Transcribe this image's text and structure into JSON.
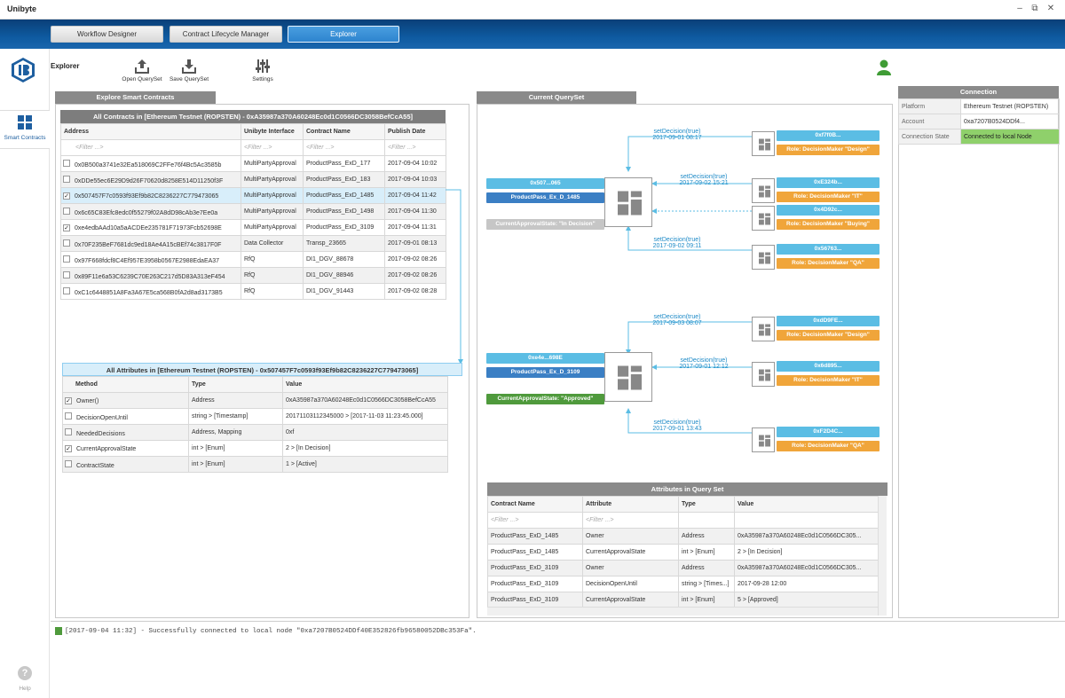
{
  "window": {
    "title": "Unibyte",
    "minimize": "‒",
    "maximize": "⧉",
    "close": "✕"
  },
  "nav": {
    "tabs": [
      {
        "label": "Workflow Designer"
      },
      {
        "label": "Contract Lifecycle Manager"
      },
      {
        "label": "Explorer"
      }
    ]
  },
  "sidebar": {
    "smart_contracts": "Smart Contracts",
    "help": "Help",
    "help_glyph": "?"
  },
  "toolbar": {
    "title": "Explorer",
    "open": "Open QuerySet",
    "save": "Save QuerySet",
    "settings": "Settings"
  },
  "explore": {
    "header": "Explore Smart Contracts",
    "contracts": {
      "caption": "All Contracts in [Ethereum Testnet (ROPSTEN) - 0xA35987a370A60248Ec0d1C0566DC3058BefCcA55]",
      "columns": [
        "Address",
        "Unibyte Interface",
        "Contract Name",
        "Publish Date"
      ],
      "filter": "<Filter ...>",
      "rows": [
        {
          "checked": false,
          "address": "0x0B500a3741e32Ea518069C2FFe76f4Bc5Ac3585b",
          "iface": "MultiPartyApproval",
          "name": "ProductPass_ExD_177",
          "date": "2017-09-04 10:02"
        },
        {
          "checked": false,
          "address": "0xDDe55ec6E29D9d26F70620d8258E514D11250f3F",
          "iface": "MultiPartyApproval",
          "name": "ProductPass_ExD_183",
          "date": "2017-09-04 10:03"
        },
        {
          "checked": true,
          "address": "0x507457F7c0593f93Ef9b82C8236227C779473065",
          "iface": "MultiPartyApproval",
          "name": "ProductPass_ExD_1485",
          "date": "2017-09-04 11:42"
        },
        {
          "checked": false,
          "address": "0x6c65C83Efc8edc0f55279f02A8dD98cAb3e7Ee0a",
          "iface": "MultiPartyApproval",
          "name": "ProductPass_ExD_1498",
          "date": "2017-09-04 11:30"
        },
        {
          "checked": true,
          "address": "0xe4edbAAd10a5aACDEe235781F71973Fcb52698E",
          "iface": "MultiPartyApproval",
          "name": "ProductPass_ExD_3109",
          "date": "2017-09-04 11:31"
        },
        {
          "checked": false,
          "address": "0x70F235BeF7681dc9ed18Ae4A15cBEf74c3817F0F",
          "iface": "Data Collector",
          "name": "Transp_23665",
          "date": "2017-09-01 08:13"
        },
        {
          "checked": false,
          "address": "0x97F668fdcf8C4Ef957E3958b0567E2988EdaEA37",
          "iface": "RfQ",
          "name": "DI1_DGV_88678",
          "date": "2017-09-02 08:26"
        },
        {
          "checked": false,
          "address": "0x89F11e6a53C6239C70E263C217d5D83A313eF454",
          "iface": "RfQ",
          "name": "DI1_DGV_88946",
          "date": "2017-09-02 08:26"
        },
        {
          "checked": false,
          "address": "0xC1c6448851A8Fa3A67E5ca568B0fA2d8ad3173B5",
          "iface": "RfQ",
          "name": "DI1_DGV_91443",
          "date": "2017-09-02 08:28"
        }
      ]
    },
    "attributes": {
      "caption": "All Attributes in [Ethereum Testnet (ROPSTEN) - 0x507457F7c0593f93Ef9b82C8236227C779473065]",
      "columns": [
        "Method",
        "Type",
        "Value"
      ],
      "rows": [
        {
          "checked": true,
          "method": "Owner()",
          "type": "Address",
          "value": "0xA35987a370A60248Ec0d1C0566DC3058BefCcA55"
        },
        {
          "checked": false,
          "method": "DecisionOpenUntil",
          "type": "string > [Timestamp]",
          "value": "20171103112345000 > [2017-11-03 11:23:45.000]"
        },
        {
          "checked": false,
          "method": "NeededDecisions",
          "type": "Address, Mapping",
          "value": "0xf"
        },
        {
          "checked": true,
          "method": "CurrentApprovalState",
          "type": "int > [Enum]",
          "value": "2 > [In Decision]"
        },
        {
          "checked": false,
          "method": "ContractState",
          "type": "int > [Enum]",
          "value": "1 > [Active]"
        }
      ]
    }
  },
  "queryset": {
    "header": "Current QuerySet",
    "graph1": {
      "main": {
        "addr": "0x507...065",
        "name": "ProductPass_Ex_D_1485",
        "state": "CurrentApprovalState: \"In Decision\""
      },
      "edges": [
        {
          "call": "setDecision(true)",
          "time": "2017-09-01 08:17",
          "addr": "0xf7f0B...",
          "role": "Role: DecisionMaker \"Design\""
        },
        {
          "call": "setDecision(true)",
          "time": "2017-09-02 15:21",
          "addr": "0xE324b...",
          "role": "Role: DecisionMaker \"IT\""
        },
        {
          "call": "",
          "time": "",
          "addr": "0x4D92c...",
          "role": "Role: DecisionMaker \"Buying\""
        },
        {
          "call": "setDecision(true)",
          "time": "2017-09-02 09:11",
          "addr": "0x56763...",
          "role": "Role: DecisionMaker \"QA\""
        }
      ]
    },
    "graph2": {
      "main": {
        "addr": "0xe4e...698E",
        "name": "ProductPass_Ex_D_3109",
        "state": "CurrentApprovalState: \"Approved\""
      },
      "edges": [
        {
          "call": "setDecision(true)",
          "time": "2017-09-03 08:07",
          "addr": "0xdD9FE...",
          "role": "Role: DecisionMaker \"Design\""
        },
        {
          "call": "setDecision(true)",
          "time": "2017-09-01 12:12",
          "addr": "0x6d895...",
          "role": "Role: DecisionMaker \"IT\""
        },
        {
          "call": "setDecision(true)",
          "time": "2017-09-01 13:43",
          "addr": "0xF2D4C...",
          "role": "Role: DecisionMaker \"QA\""
        }
      ]
    },
    "attrs": {
      "caption": "Attributes in Query Set",
      "columns": [
        "Contract Name",
        "Attribute",
        "Type",
        "Value"
      ],
      "filter": "<Filter ...>",
      "rows": [
        {
          "name": "ProductPass_ExD_1485",
          "attr": "Owner",
          "type": "Address",
          "value": "0xA35987a370A60248Ec0d1C0566DC305..."
        },
        {
          "name": "ProductPass_ExD_1485",
          "attr": "CurrentApprovalState",
          "type": "int > [Enum]",
          "value": "2 > [In Decision]"
        },
        {
          "name": "ProductPass_ExD_3109",
          "attr": "Owner",
          "type": "Address",
          "value": "0xA35987a370A60248Ec0d1C0566DC305..."
        },
        {
          "name": "ProductPass_ExD_3109",
          "attr": "DecisionOpenUntil",
          "type": "string > [Times...]",
          "value": "2017-09-28 12:00"
        },
        {
          "name": "ProductPass_ExD_3109",
          "attr": "CurrentApprovalState",
          "type": "int > [Enum]",
          "value": "5 > [Approved]"
        }
      ]
    }
  },
  "connection": {
    "header": "Connection",
    "rows": [
      {
        "label": "Platform",
        "value": "Ethereum Testnet (ROPSTEN)"
      },
      {
        "label": "Account",
        "value": "0xa7207B0524DDf4..."
      },
      {
        "label": "Connection State",
        "value": "Connected to local Node"
      }
    ]
  },
  "log": {
    "text": "[2017-09-04 11:32] - Successfully connected to local node \"0xa7207B0524DDf40E352826fb96580052DBc353Fa\"."
  },
  "colors": {
    "accent": "#2d84cf",
    "connected": "#8fd06b",
    "role": "#f0a53a",
    "addr": "#5bbde4",
    "approved": "#4f9a3c"
  }
}
